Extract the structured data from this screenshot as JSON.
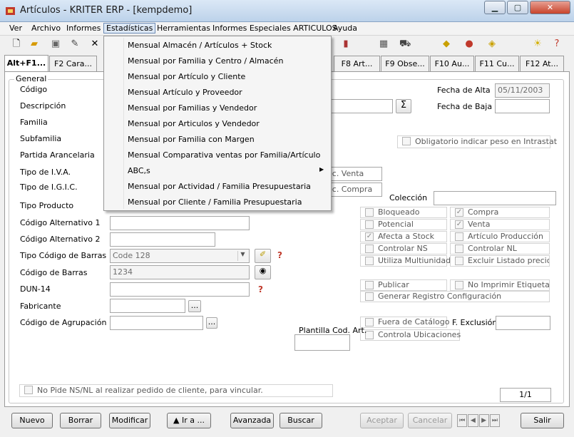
{
  "window": {
    "title": "Artículos - KRITER ERP - [kempdemo]"
  },
  "menubar": {
    "ver": "Ver",
    "archivo": "Archivo",
    "informes": "Informes",
    "estadisticas": "Estadísticas",
    "herramientas": "Herramientas",
    "informes_especiales": "Informes Especiales ARTICULOS",
    "ayuda": "Ayuda"
  },
  "dropdown": {
    "items": [
      "Mensual Almacén / Artículos + Stock",
      "Mensual por Familia y Centro / Almacén",
      "Mensual por Artículo y Cliente",
      "Mensual Artículo y Proveedor",
      "Mensual por Familias y Vendedor",
      "Mensual por Articulos y Vendedor",
      "Mensual por Familia con Margen",
      "Mensual Comparativa ventas por Familia/Artículo",
      "ABC,s",
      "Mensual por Actividad / Familia Presupuestaria",
      "Mensual por Cliente / Familia Presupuestaria"
    ]
  },
  "tabs": [
    "Alt+F1...",
    "F2 Cara...",
    "F8 Art...",
    "F9 Obse...",
    "F10 Au...",
    "F11 Cu...",
    "F12 At..."
  ],
  "group": {
    "legend": "General"
  },
  "labels": {
    "codigo": "Código",
    "descripcion": "Descripción",
    "familia": "Familia",
    "subfamilia": "Subfamilia",
    "partida": "Partida Arancelaria",
    "tipo_iva": "Tipo de I.V.A.",
    "tipo_igic": "Tipo de I.G.I.C.",
    "tipo_producto": "Tipo Producto",
    "cod_alt1": "Código Alternativo 1",
    "cod_alt2": "Código Alternativo 2",
    "tipo_cod_barras": "Tipo Código de Barras",
    "cod_barras": "Código de Barras",
    "dun14": "DUN-14",
    "fabricante": "Fabricante",
    "cod_agrupacion": "Código de Agrupación",
    "fecha_alta": "Fecha de Alta",
    "fecha_baja": "Fecha de Baja",
    "coleccion": "Colección",
    "rec_venta": "ec. Venta",
    "rec_compra": "ec. Compra",
    "plantilla": "Plantilla Cod. Art.",
    "f_exclusion": "F. Exclusión"
  },
  "values": {
    "fecha_alta": "05/11/2003",
    "tipo_cod_barras": "Code 128",
    "cod_barras": "1234",
    "pager": "1/1",
    "sigma": "Σ",
    "ellipsis": "...",
    "ellipsis2": "..."
  },
  "checks": {
    "intrastat": "Obligatorio indicar peso en Intrastat",
    "bloqueado": "Bloqueado",
    "compra": "Compra",
    "potencial": "Potencial",
    "venta": "Venta",
    "afecta_stock": "Afecta a Stock",
    "articulo_produccion": "Artículo Producción",
    "controlar_ns": "Controlar NS",
    "controlar_nl": "Controlar NL",
    "multiunidad": "Utiliza Multiunidad",
    "excluir_listado": "Excluir Listado precio n",
    "publicar": "Publicar",
    "no_imprimir": "No Imprimir Etiqueta",
    "generar_registro": "Generar Registro Configuración",
    "fuera_catalogo": "Fuera de Catálogo",
    "controla_ubicaciones": "Controla Ubicaciones",
    "no_pide": "No Pide NS/NL al realizar pedido de cliente, para vincular."
  },
  "buttons": {
    "nuevo": "Nuevo",
    "borrar": "Borrar",
    "modificar": "Modificar",
    "ira": "▲ Ir a ...",
    "avanzada": "Avanzada",
    "buscar": "Buscar",
    "aceptar": "Aceptar",
    "cancelar": "Cancelar",
    "salir": "Salir"
  }
}
